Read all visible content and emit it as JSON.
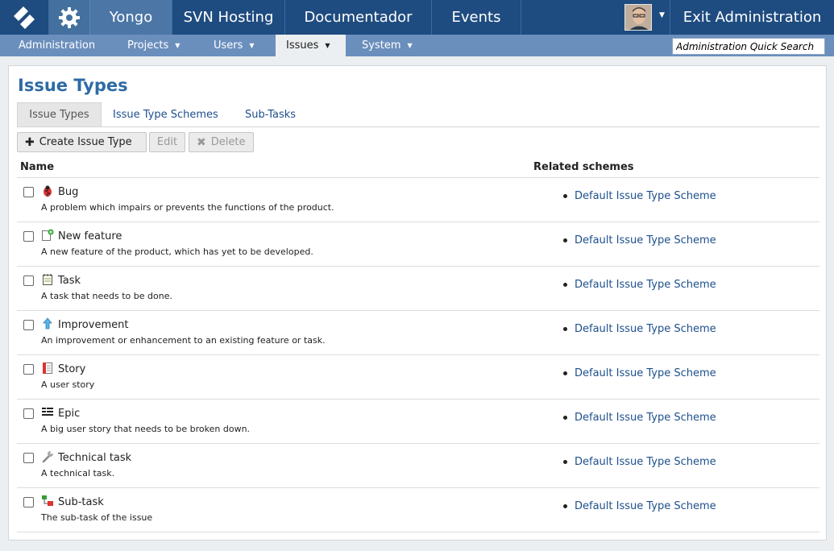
{
  "topbar": {
    "nav": [
      {
        "label": "Yongo"
      },
      {
        "label": "SVN Hosting"
      },
      {
        "label": "Documentador"
      },
      {
        "label": "Events"
      }
    ],
    "exit_label": "Exit Administration"
  },
  "subbar": {
    "items": [
      {
        "label": "Administration"
      },
      {
        "label": "Projects"
      },
      {
        "label": "Users"
      },
      {
        "label": "Issues"
      },
      {
        "label": "System"
      }
    ],
    "search_placeholder": "Administration Quick Search"
  },
  "page": {
    "title": "Issue Types",
    "tabs": [
      {
        "label": "Issue Types"
      },
      {
        "label": "Issue Type Schemes"
      },
      {
        "label": "Sub-Tasks"
      }
    ],
    "buttons": {
      "create": "Create Issue Type",
      "edit": "Edit",
      "delete": "Delete"
    },
    "columns": {
      "name": "Name",
      "related": "Related schemes"
    },
    "issue_types": [
      {
        "name": "Bug",
        "description": "A problem which impairs or prevents the functions of the product.",
        "scheme": "Default Issue Type Scheme",
        "icon": "bug-icon"
      },
      {
        "name": "New feature",
        "description": "A new feature of the product, which has yet to be developed.",
        "scheme": "Default Issue Type Scheme",
        "icon": "new-feature-icon"
      },
      {
        "name": "Task",
        "description": "A task that needs to be done.",
        "scheme": "Default Issue Type Scheme",
        "icon": "task-icon"
      },
      {
        "name": "Improvement",
        "description": "An improvement or enhancement to an existing feature or task.",
        "scheme": "Default Issue Type Scheme",
        "icon": "improvement-icon"
      },
      {
        "name": "Story",
        "description": "A user story",
        "scheme": "Default Issue Type Scheme",
        "icon": "story-icon"
      },
      {
        "name": "Epic",
        "description": "A big user story that needs to be broken down.",
        "scheme": "Default Issue Type Scheme",
        "icon": "epic-icon"
      },
      {
        "name": "Technical task",
        "description": "A technical task.",
        "scheme": "Default Issue Type Scheme",
        "icon": "technical-task-icon"
      },
      {
        "name": "Sub-task",
        "description": "The sub-task of the issue",
        "scheme": "Default Issue Type Scheme",
        "icon": "sub-task-icon"
      }
    ]
  },
  "colors": {
    "topbar": "#1f4c80",
    "subbar": "#6b8fbd",
    "link": "#1d4f8c",
    "title": "#2e6aa5"
  }
}
